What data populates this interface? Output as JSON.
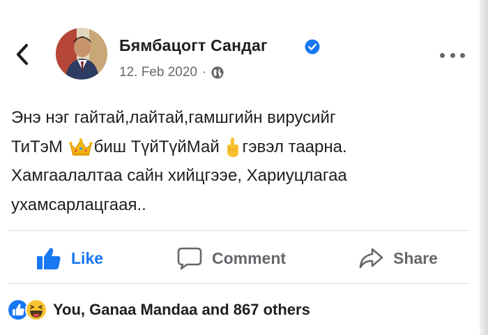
{
  "post": {
    "author_name": "Бямбацогт Сандаг",
    "date": "12. Feb 2020",
    "separator": "·",
    "privacy_icon": "globe-icon",
    "verified_icon": "verified-badge-icon",
    "text_lines": [
      [
        "Энэ нэг гайтай,лайтай,гамшгийн вирусийг"
      ],
      [
        "ТиТэМ ",
        "биш ТүйТүйМай ",
        "гэвэл таарна."
      ],
      [
        "Хамгаалалтаа сайн хийцгээе, Хариуцлагаа"
      ],
      [
        "ухамсарлацгаая.."
      ]
    ],
    "inline_emojis": [
      "crown-emoji",
      "pointing-hand-emoji"
    ]
  },
  "actions": {
    "like_label": "Like",
    "comment_label": "Comment",
    "share_label": "Share"
  },
  "reactions": {
    "icons": [
      "like-reaction-icon",
      "haha-reaction-icon"
    ],
    "summary": "You, Ganaa Mandaa and 867 others"
  },
  "colors": {
    "brand_blue": "#1877f2",
    "text_primary": "#1c1e21",
    "text_secondary": "#65676b",
    "divider": "#dadde1"
  }
}
